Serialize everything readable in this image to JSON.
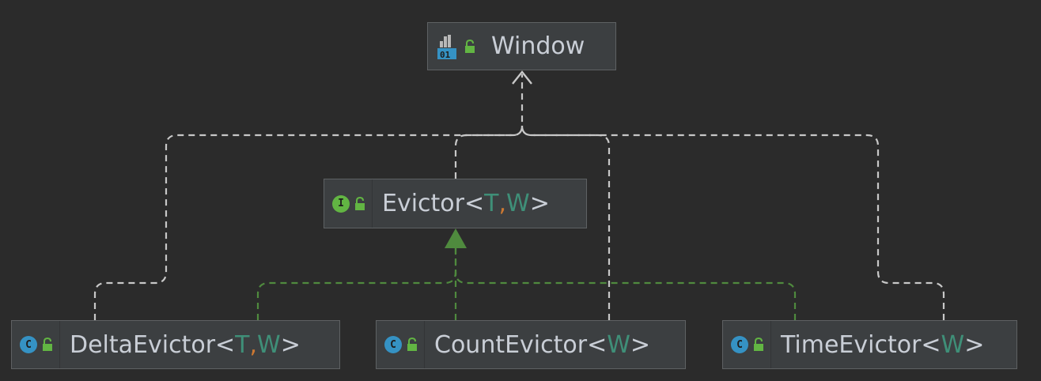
{
  "colors": {
    "background": "#2b2b2b",
    "node_fill": "#3c3f41",
    "node_border": "#5e6163",
    "implements_edge": "#4f8a3e",
    "extends_edge": "#c8c8c8",
    "type_param": "#3f8f78",
    "comma": "#cc7832",
    "class_badge": "#3592c4",
    "interface_badge": "#62b543"
  },
  "nodes": {
    "window": {
      "name": "Window",
      "icon": "abstract-class-binary-icon"
    },
    "evictor": {
      "base": "Evictor<",
      "p1": "T",
      "comma": ", ",
      "p2": "W",
      "close": ">",
      "badge": "I",
      "icon": "interface-icon"
    },
    "delta": {
      "base": "DeltaEvictor<",
      "p1": "T",
      "comma": ", ",
      "p2": "W",
      "close": ">",
      "badge": "C",
      "icon": "class-icon"
    },
    "count": {
      "base": "CountEvictor<",
      "p1": "W",
      "close": ">",
      "badge": "C",
      "icon": "class-icon"
    },
    "time": {
      "base": "TimeEvictor<",
      "p1": "W",
      "close": ">",
      "badge": "C",
      "icon": "class-icon"
    }
  }
}
